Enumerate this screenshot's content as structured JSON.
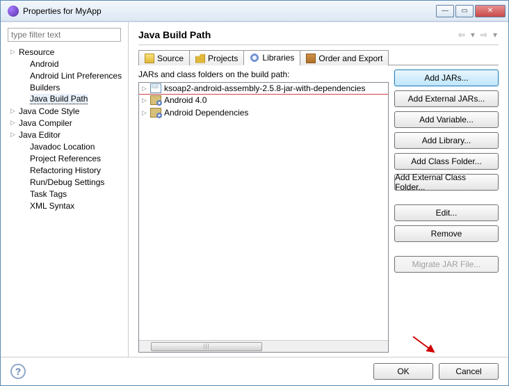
{
  "titlebar": {
    "title": "Properties for MyApp"
  },
  "filter": {
    "placeholder": "type filter text"
  },
  "tree": {
    "items": [
      {
        "label": "Resource",
        "expandable": true,
        "level": 0
      },
      {
        "label": "Android",
        "expandable": false,
        "level": 1
      },
      {
        "label": "Android Lint Preferences",
        "expandable": false,
        "level": 1
      },
      {
        "label": "Builders",
        "expandable": false,
        "level": 1
      },
      {
        "label": "Java Build Path",
        "expandable": false,
        "level": 1,
        "selected": true
      },
      {
        "label": "Java Code Style",
        "expandable": true,
        "level": 0
      },
      {
        "label": "Java Compiler",
        "expandable": true,
        "level": 0
      },
      {
        "label": "Java Editor",
        "expandable": true,
        "level": 0
      },
      {
        "label": "Javadoc Location",
        "expandable": false,
        "level": 1
      },
      {
        "label": "Project References",
        "expandable": false,
        "level": 1
      },
      {
        "label": "Refactoring History",
        "expandable": false,
        "level": 1
      },
      {
        "label": "Run/Debug Settings",
        "expandable": false,
        "level": 1
      },
      {
        "label": "Task Tags",
        "expandable": false,
        "level": 1
      },
      {
        "label": "XML Syntax",
        "expandable": false,
        "level": 1
      }
    ]
  },
  "page": {
    "title": "Java Build Path"
  },
  "tabs": {
    "source": "Source",
    "projects": "Projects",
    "libraries": "Libraries",
    "order": "Order and Export"
  },
  "libraries": {
    "caption": "JARs and class folders on the build path:",
    "entries": [
      {
        "label": "ksoap2-android-assembly-2.5.8-jar-with-dependencies",
        "icon": "jar",
        "highlighted": true
      },
      {
        "label": "Android 4.0",
        "icon": "libfolder"
      },
      {
        "label": "Android Dependencies",
        "icon": "libfolder"
      }
    ]
  },
  "buttons": {
    "add_jars": "Add JARs...",
    "add_external_jars": "Add External JARs...",
    "add_variable": "Add Variable...",
    "add_library": "Add Library...",
    "add_class_folder": "Add Class Folder...",
    "add_external_class_folder": "Add External Class Folder...",
    "edit": "Edit...",
    "remove": "Remove",
    "migrate": "Migrate JAR File..."
  },
  "footer": {
    "ok": "OK",
    "cancel": "Cancel"
  }
}
